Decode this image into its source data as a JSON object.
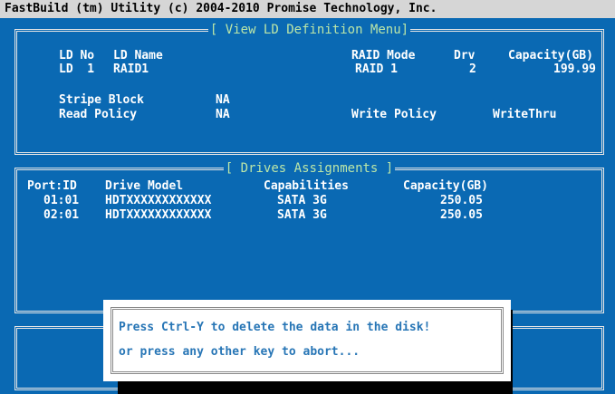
{
  "app_title": "FastBuild (tm) Utility (c) 2004-2010 Promise Technology, Inc.",
  "ld_menu": {
    "title": "[ View LD Definition Menu]",
    "headers": {
      "ld_no": "LD No",
      "ld_name": "LD Name",
      "raid_mode": "RAID Mode",
      "drv": "Drv",
      "capacity": "Capacity(GB)"
    },
    "row": {
      "ld_no": "LD  1",
      "ld_name": "RAID1",
      "raid_mode": "RAID 1",
      "drv": "2",
      "capacity": "199.99"
    },
    "stripe_label": "Stripe Block",
    "stripe_value": "NA",
    "read_label": "Read Policy",
    "read_value": "NA",
    "write_label": "Write Policy",
    "write_value": "WriteThru"
  },
  "drives": {
    "title": "[ Drives Assignments ]",
    "headers": {
      "port": "Port:ID",
      "model": "Drive Model",
      "capabilities": "Capabilities",
      "capacity": "Capacity(GB)"
    },
    "rows": [
      {
        "port": "01:01",
        "model": "HDTXXXXXXXXXXXX",
        "capabilities": "SATA 3G",
        "capacity": "250.05"
      },
      {
        "port": "02:01",
        "model": "HDTXXXXXXXXXXXX",
        "capabilities": "SATA 3G",
        "capacity": "250.05"
      }
    ]
  },
  "dialog": {
    "line1": "Press Ctrl-Y to delete the data in the disk!",
    "line2": "or press any other key to abort..."
  }
}
